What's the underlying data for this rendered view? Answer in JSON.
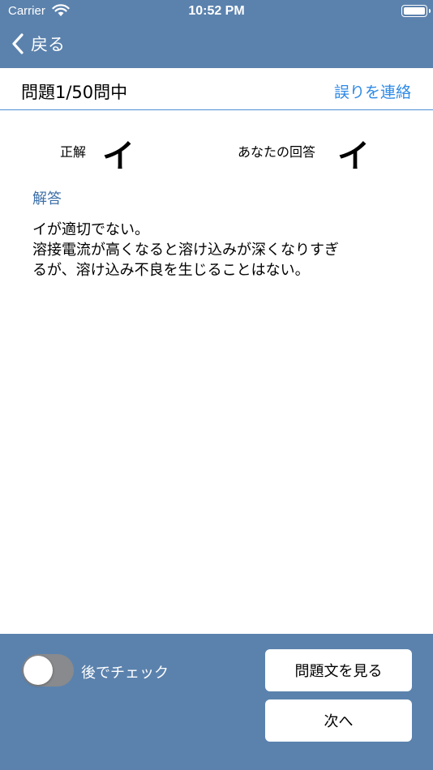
{
  "status_bar": {
    "carrier": "Carrier",
    "time": "10:52 PM"
  },
  "nav": {
    "back_label": "戻る"
  },
  "header": {
    "question_count": "問題1/50問中",
    "report_label": "誤りを連絡"
  },
  "answers": {
    "correct_label": "正解",
    "correct_value": "イ",
    "yours_label": "あなたの回答",
    "yours_value": "イ"
  },
  "explanation": {
    "title": "解答",
    "lines": [
      "イが適切でない。",
      "溶接電流が高くなると溶け込みが深くなりすぎ",
      "るが、溶け込み不良を生じることはない。"
    ]
  },
  "footer": {
    "toggle_label": "後でチェック",
    "toggle_on": false,
    "view_question_label": "問題文を見る",
    "next_label": "次へ"
  },
  "colors": {
    "bar": "#5b82ad",
    "accent": "#2e8ae6",
    "section_title": "#3c6fa8"
  }
}
